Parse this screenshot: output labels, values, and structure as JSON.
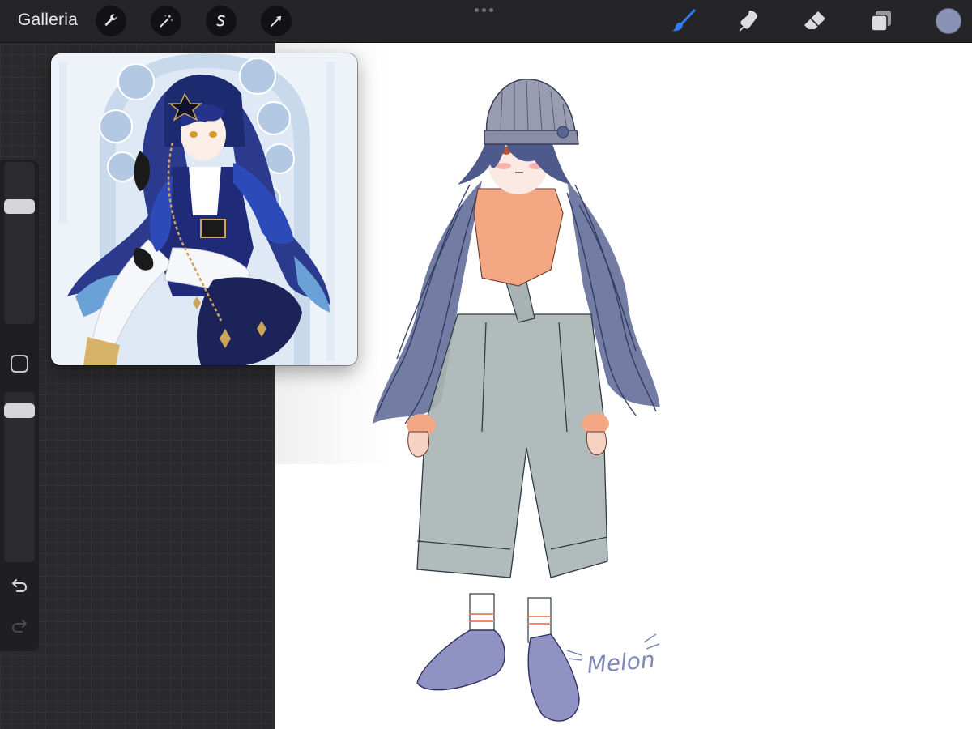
{
  "topbar": {
    "gallery_label": "Galleria",
    "left_tools": [
      {
        "name": "actions",
        "icon": "wrench-icon"
      },
      {
        "name": "adjustments",
        "icon": "magic-wand-icon"
      },
      {
        "name": "selection",
        "icon": "selection-s-icon"
      },
      {
        "name": "transform",
        "icon": "arrow-cursor-icon"
      }
    ],
    "right_tools": [
      {
        "name": "brush",
        "icon": "brush-icon",
        "active": true
      },
      {
        "name": "smudge",
        "icon": "smudge-icon",
        "active": false
      },
      {
        "name": "eraser",
        "icon": "eraser-icon",
        "active": false
      },
      {
        "name": "layers",
        "icon": "layers-icon",
        "active": false
      }
    ],
    "current_color": "#8a93b6",
    "accent_color": "#2f7cf6"
  },
  "sidebar": {
    "brush_size_level": 0.85,
    "opacity_level": 0.95,
    "modify_button_icon": "square-icon",
    "undo_icon": "undo-icon",
    "redo_icon": "redo-icon"
  },
  "reference": {
    "title_visible": false,
    "image_description_icon": "reference-image"
  },
  "canvas": {
    "signature": "Melon",
    "background": "#ffffff"
  }
}
